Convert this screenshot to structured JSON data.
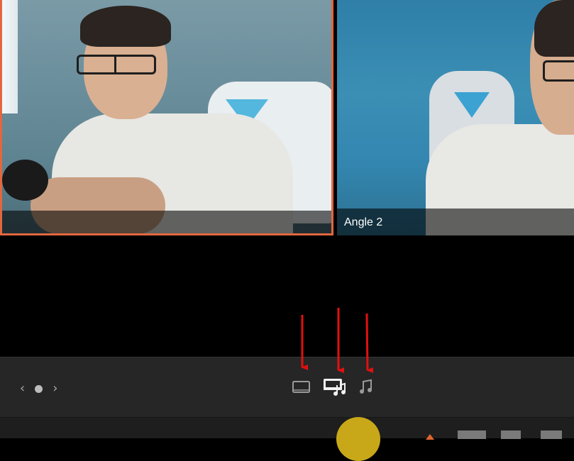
{
  "viewer": {
    "angle1": {
      "label": "",
      "active": true,
      "border_color": "#e2673f"
    },
    "angle2": {
      "label": "Angle 2"
    }
  },
  "toolbar": {
    "nav_prev_glyph": "‹",
    "nav_next_glyph": "›",
    "modes": [
      {
        "name": "video-only",
        "icon": "video-icon"
      },
      {
        "name": "audio-and-video",
        "icon": "av-icon",
        "active": true
      },
      {
        "name": "audio-only",
        "icon": "music-note-icon"
      }
    ]
  },
  "colors": {
    "accent": "#e2673f",
    "annotation_arrow": "#e01010",
    "playhead": "#c8a818",
    "toolbar_bg": "#262626"
  }
}
